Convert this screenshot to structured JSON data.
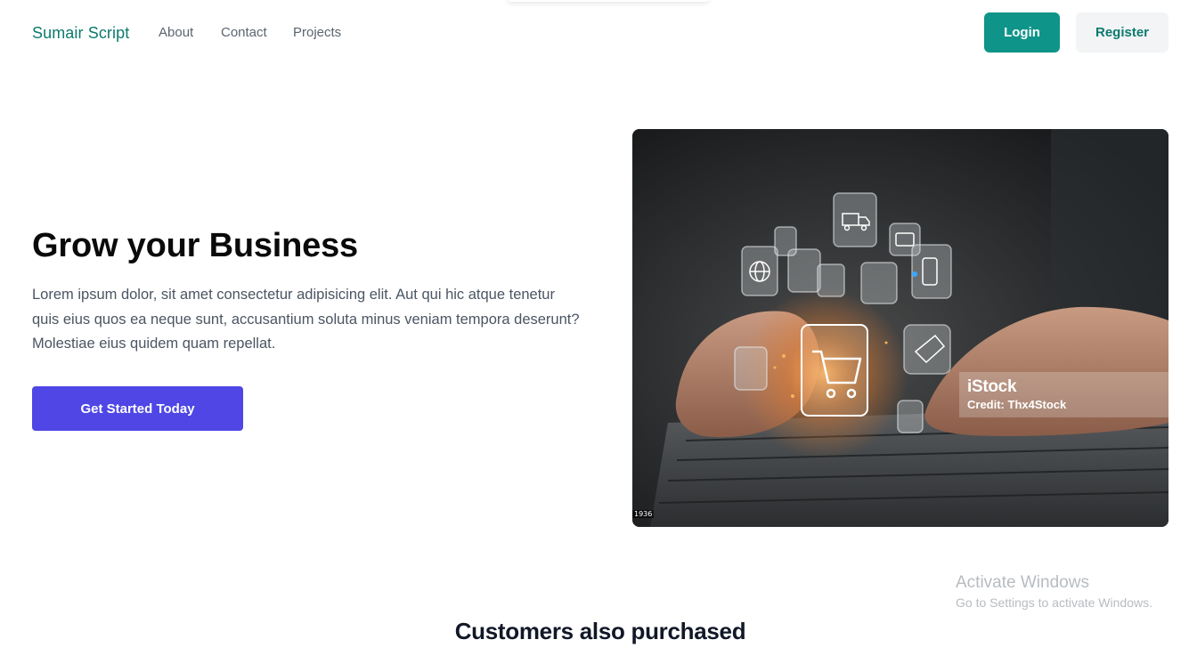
{
  "nav": {
    "brand": "Sumair Script",
    "links": [
      "About",
      "Contact",
      "Projects"
    ],
    "login_label": "Login",
    "register_label": "Register"
  },
  "hero": {
    "title": "Grow your Business",
    "description": "Lorem ipsum dolor, sit amet consectetur adipisicing elit. Aut qui hic atque tenetur quis eius quos ea neque sunt, accusantium soluta minus veniam tempora deserunt? Molestiae eius quidem quam repellat.",
    "cta_label": "Get Started Today",
    "image": {
      "watermark_brand": "iStock",
      "credit": "Credit: Thx4Stock",
      "image_id": "1936"
    }
  },
  "section": {
    "title": "Customers also purchased"
  },
  "os_watermark": {
    "title": "Activate Windows",
    "subtitle": "Go to Settings to activate Windows."
  },
  "colors": {
    "brand": "#0d7a6d",
    "login_bg": "#0e9488",
    "register_bg": "#f2f4f6",
    "cta_bg": "#4f46e5"
  }
}
